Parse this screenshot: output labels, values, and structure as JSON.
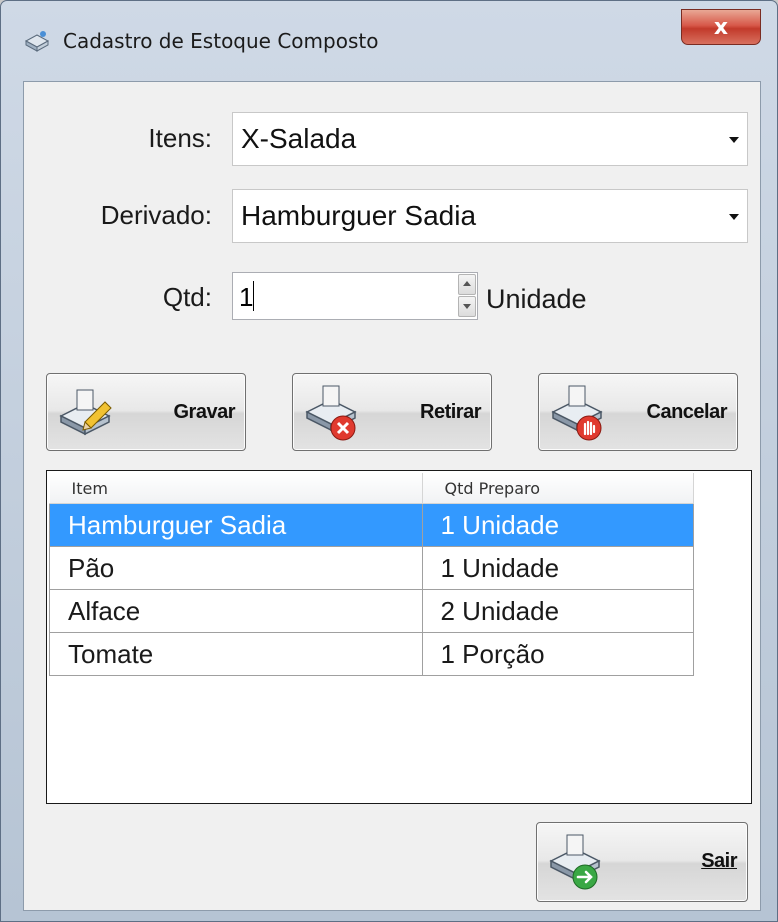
{
  "window": {
    "title": "Cadastro de Estoque Composto",
    "close_label": "x"
  },
  "form": {
    "itens_label": "Itens:",
    "itens_value": "X-Salada",
    "derivado_label": "Derivado:",
    "derivado_value": "Hamburguer Sadia",
    "qtd_label": "Qtd:",
    "qtd_value": "1",
    "unit_label": "Unidade"
  },
  "buttons": {
    "gravar": "Gravar",
    "retirar": "Retirar",
    "cancelar": "Cancelar",
    "sair": "Sair"
  },
  "grid": {
    "columns": [
      "Item",
      "Qtd Preparo"
    ],
    "rows": [
      {
        "item": "Hamburguer Sadia",
        "qtd": "1 Unidade",
        "selected": true
      },
      {
        "item": "Pão",
        "qtd": "1 Unidade"
      },
      {
        "item": "Alface",
        "qtd": "2 Unidade"
      },
      {
        "item": "Tomate",
        "qtd": "1 Porção"
      }
    ]
  },
  "colors": {
    "selection": "#3399ff",
    "close": "#c23a2b"
  }
}
